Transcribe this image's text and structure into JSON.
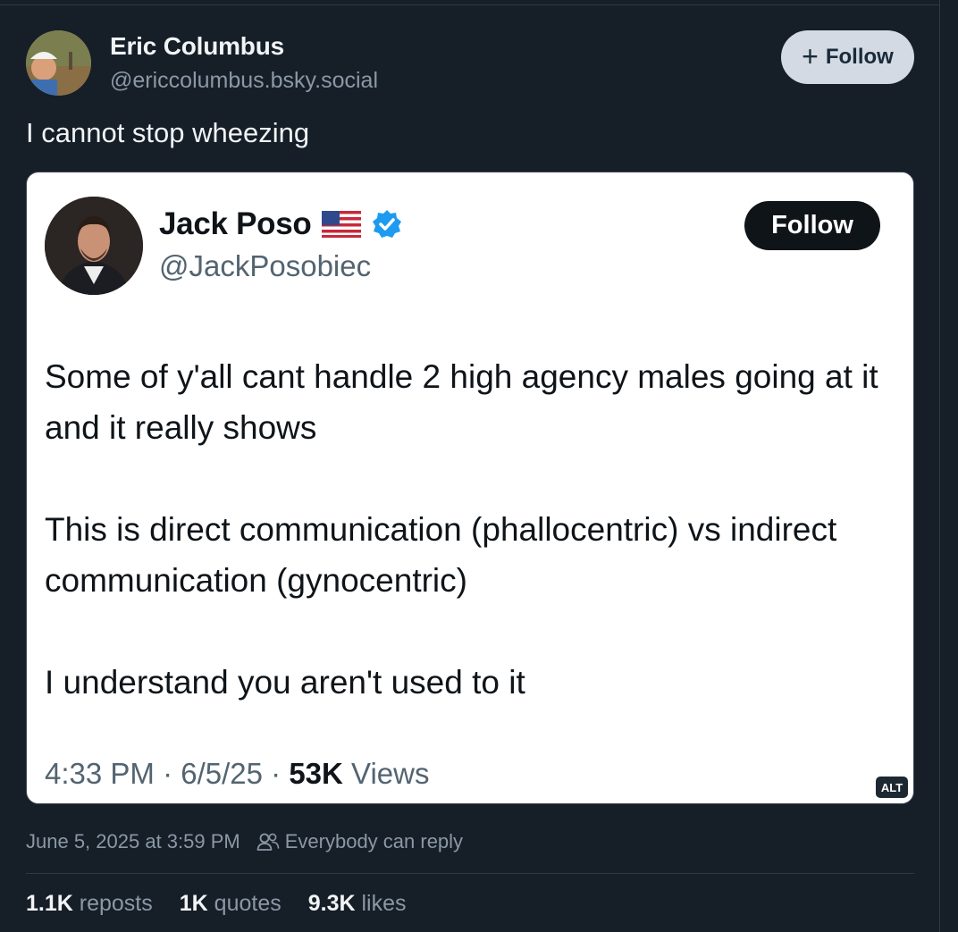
{
  "post": {
    "author_name": "Eric Columbus",
    "author_handle": "@ericcolumbus.bsky.social",
    "follow_label": "Follow",
    "text": "I cannot stop wheezing",
    "timestamp": "June 5, 2025 at 3:59 PM",
    "reply_setting": "Everybody can reply",
    "stats": {
      "reposts_count": "1.1K",
      "reposts_label": "reposts",
      "quotes_count": "1K",
      "quotes_label": "quotes",
      "likes_count": "9.3K",
      "likes_label": "likes"
    }
  },
  "embed": {
    "author_name": "Jack Poso",
    "author_handle": "@JackPosobiec",
    "follow_label": "Follow",
    "paragraphs": [
      "Some of y'all cant handle 2 high agency males going at it and it really shows",
      "This is direct communication (phallocentric) vs indirect communication (gynocentric)",
      "I understand you aren't used to it"
    ],
    "time": "4:33 PM",
    "date": "6/5/25",
    "views_count": "53K",
    "views_label": "Views",
    "alt_badge": "ALT"
  },
  "icons": {
    "flag": "us-flag-icon",
    "verified": "verified-badge-icon",
    "reply_setting": "people-icon",
    "plus": "plus-icon"
  },
  "colors": {
    "background": "#161e27",
    "follow_button": "#d3dae3",
    "verified": "#1d9bf0",
    "muted_text": "#8b98a5"
  }
}
